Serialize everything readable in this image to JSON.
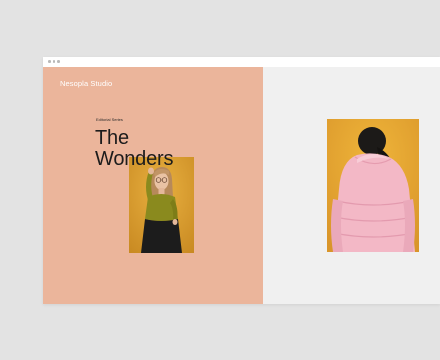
{
  "window": {
    "controls": [
      "window-dot",
      "window-dot",
      "window-dot"
    ]
  },
  "header": {
    "brand": "Nesopla Studio"
  },
  "hero": {
    "kicker": "Editorial Series",
    "title_line1": "The",
    "title_line2": "Wonders"
  },
  "colors": {
    "left_panel": "#ebb59b",
    "right_panel": "#f0f0f0",
    "photo_background": "#e3a631",
    "top_color": "#8a8a1e",
    "jacket_color": "#f3b8c6"
  }
}
